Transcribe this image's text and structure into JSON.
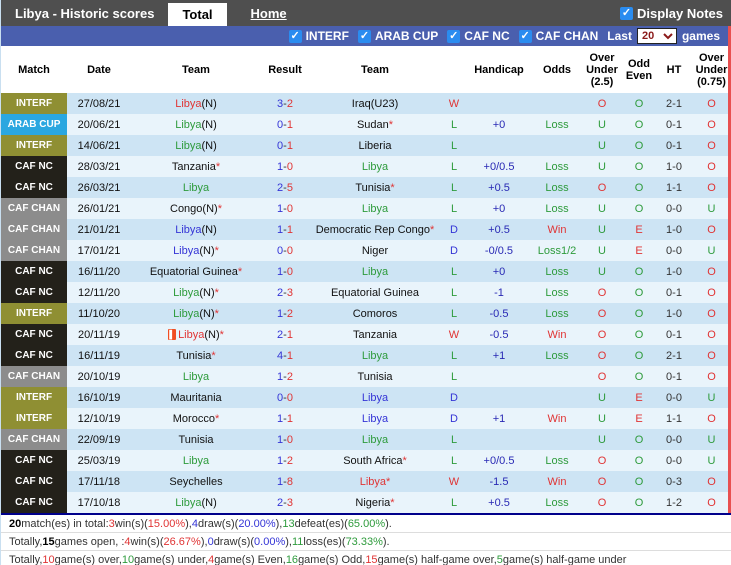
{
  "header": {
    "title": "Libya - Historic scores",
    "tabs": [
      {
        "label": "Total",
        "active": true
      },
      {
        "label": "Home",
        "active": false
      }
    ],
    "display_notes_label": "Display Notes",
    "display_notes_checked": true
  },
  "filter_bar": {
    "competitions": [
      {
        "label": "INTERF",
        "checked": true
      },
      {
        "label": "ARAB CUP",
        "checked": true
      },
      {
        "label": "CAF NC",
        "checked": true
      },
      {
        "label": "CAF CHAN",
        "checked": true
      }
    ],
    "last_label": "Last",
    "last_value": "20",
    "games_label": "games"
  },
  "colors": {
    "win_red": "#e03434",
    "loss_green": "#2e9b3c",
    "draw_blue": "#3434d6",
    "handicap_navy": "#2828b4",
    "badge_interf": "#8f8f33",
    "badge_arab_cup": "#2aa7e0",
    "badge_caf_nc": "#23211a",
    "badge_caf_chan": "#8c8c8c",
    "stripe_dark": "#cde4f4",
    "stripe_light": "#e9f4fb",
    "filter_bar_blue": "#4a5fae",
    "topbar_gray": "#4f4f4f",
    "right_edge_red": "#e85050"
  },
  "table": {
    "headers": [
      "Match",
      "Date",
      "Team",
      "Result",
      "Team",
      "",
      "Handicap",
      "Odds",
      "Over Under (2.5)",
      "Odd Even",
      "HT",
      "Over Under (0.75)"
    ],
    "rows": [
      {
        "comp": "INTERF",
        "date": "27/08/21",
        "t1": "Libya",
        "t1s": "(N)",
        "t1r": "W",
        "t1star": false,
        "card": false,
        "rh": "3",
        "ra": "2",
        "t2": "Iraq(U23)",
        "t2s": "",
        "t2r": "",
        "t2star": false,
        "wld": "W",
        "hcap": "",
        "odds": "",
        "ou25": "O",
        "oe": "O",
        "ht": "2-1",
        "ou075": "O"
      },
      {
        "comp": "ARAB CUP",
        "date": "20/06/21",
        "t1": "Libya",
        "t1s": "(N)",
        "t1r": "L",
        "t1star": false,
        "card": false,
        "rh": "0",
        "ra": "1",
        "t2": "Sudan",
        "t2s": "",
        "t2r": "",
        "t2star": true,
        "wld": "L",
        "hcap": "+0",
        "odds": "Loss",
        "ou25": "U",
        "oe": "O",
        "ht": "0-1",
        "ou075": "O"
      },
      {
        "comp": "INTERF",
        "date": "14/06/21",
        "t1": "Libya",
        "t1s": "(N)",
        "t1r": "L",
        "t1star": false,
        "card": false,
        "rh": "0",
        "ra": "1",
        "t2": "Liberia",
        "t2s": "",
        "t2r": "",
        "t2star": false,
        "wld": "L",
        "hcap": "",
        "odds": "",
        "ou25": "U",
        "oe": "O",
        "ht": "0-1",
        "ou075": "O"
      },
      {
        "comp": "CAF NC",
        "date": "28/03/21",
        "t1": "Tanzania",
        "t1s": "",
        "t1r": "",
        "t1star": true,
        "card": false,
        "rh": "1",
        "ra": "0",
        "t2": "Libya",
        "t2s": "",
        "t2r": "L",
        "t2star": false,
        "wld": "L",
        "hcap": "+0/0.5",
        "odds": "Loss",
        "ou25": "U",
        "oe": "O",
        "ht": "1-0",
        "ou075": "O"
      },
      {
        "comp": "CAF NC",
        "date": "26/03/21",
        "t1": "Libya",
        "t1s": "",
        "t1r": "L",
        "t1star": false,
        "card": false,
        "rh": "2",
        "ra": "5",
        "t2": "Tunisia",
        "t2s": "",
        "t2r": "",
        "t2star": true,
        "wld": "L",
        "hcap": "+0.5",
        "odds": "Loss",
        "ou25": "O",
        "oe": "O",
        "ht": "1-1",
        "ou075": "O"
      },
      {
        "comp": "CAF CHAN",
        "date": "26/01/21",
        "t1": "Congo",
        "t1s": "(N)",
        "t1r": "",
        "t1star": true,
        "card": false,
        "rh": "1",
        "ra": "0",
        "t2": "Libya",
        "t2s": "",
        "t2r": "L",
        "t2star": false,
        "wld": "L",
        "hcap": "+0",
        "odds": "Loss",
        "ou25": "U",
        "oe": "O",
        "ht": "0-0",
        "ou075": "U"
      },
      {
        "comp": "CAF CHAN",
        "date": "21/01/21",
        "t1": "Libya",
        "t1s": "(N)",
        "t1r": "D",
        "t1star": false,
        "card": false,
        "rh": "1",
        "ra": "1",
        "t2": "Democratic Rep Congo",
        "t2s": "",
        "t2r": "",
        "t2star": true,
        "wld": "D",
        "hcap": "+0.5",
        "odds": "Win",
        "ou25": "U",
        "oe": "E",
        "ht": "1-0",
        "ou075": "O"
      },
      {
        "comp": "CAF CHAN",
        "date": "17/01/21",
        "t1": "Libya",
        "t1s": "(N)",
        "t1r": "D",
        "t1star": true,
        "card": false,
        "rh": "0",
        "ra": "0",
        "t2": "Niger",
        "t2s": "",
        "t2r": "",
        "t2star": false,
        "wld": "D",
        "hcap": "-0/0.5",
        "odds": "Loss1/2",
        "ou25": "U",
        "oe": "E",
        "ht": "0-0",
        "ou075": "U"
      },
      {
        "comp": "CAF NC",
        "date": "16/11/20",
        "t1": "Equatorial Guinea",
        "t1s": "",
        "t1r": "",
        "t1star": true,
        "card": false,
        "rh": "1",
        "ra": "0",
        "t2": "Libya",
        "t2s": "",
        "t2r": "L",
        "t2star": false,
        "wld": "L",
        "hcap": "+0",
        "odds": "Loss",
        "ou25": "U",
        "oe": "O",
        "ht": "1-0",
        "ou075": "O"
      },
      {
        "comp": "CAF NC",
        "date": "12/11/20",
        "t1": "Libya",
        "t1s": "(N)",
        "t1r": "L",
        "t1star": true,
        "card": false,
        "rh": "2",
        "ra": "3",
        "t2": "Equatorial Guinea",
        "t2s": "",
        "t2r": "",
        "t2star": false,
        "wld": "L",
        "hcap": "-1",
        "odds": "Loss",
        "ou25": "O",
        "oe": "O",
        "ht": "0-1",
        "ou075": "O"
      },
      {
        "comp": "INTERF",
        "date": "11/10/20",
        "t1": "Libya",
        "t1s": "(N)",
        "t1r": "L",
        "t1star": true,
        "card": false,
        "rh": "1",
        "ra": "2",
        "t2": "Comoros",
        "t2s": "",
        "t2r": "",
        "t2star": false,
        "wld": "L",
        "hcap": "-0.5",
        "odds": "Loss",
        "ou25": "O",
        "oe": "O",
        "ht": "1-0",
        "ou075": "O"
      },
      {
        "comp": "CAF NC",
        "date": "20/11/19",
        "t1": "Libya",
        "t1s": "(N)",
        "t1r": "W",
        "t1star": true,
        "card": true,
        "rh": "2",
        "ra": "1",
        "t2": "Tanzania",
        "t2s": "",
        "t2r": "",
        "t2star": false,
        "wld": "W",
        "hcap": "-0.5",
        "odds": "Win",
        "ou25": "O",
        "oe": "O",
        "ht": "0-1",
        "ou075": "O"
      },
      {
        "comp": "CAF NC",
        "date": "16/11/19",
        "t1": "Tunisia",
        "t1s": "",
        "t1r": "",
        "t1star": true,
        "card": false,
        "rh": "4",
        "ra": "1",
        "t2": "Libya",
        "t2s": "",
        "t2r": "L",
        "t2star": false,
        "wld": "L",
        "hcap": "+1",
        "odds": "Loss",
        "ou25": "O",
        "oe": "O",
        "ht": "2-1",
        "ou075": "O"
      },
      {
        "comp": "CAF CHAN",
        "date": "20/10/19",
        "t1": "Libya",
        "t1s": "",
        "t1r": "L",
        "t1star": false,
        "card": false,
        "rh": "1",
        "ra": "2",
        "t2": "Tunisia",
        "t2s": "",
        "t2r": "",
        "t2star": false,
        "wld": "L",
        "hcap": "",
        "odds": "",
        "ou25": "O",
        "oe": "O",
        "ht": "0-1",
        "ou075": "O"
      },
      {
        "comp": "INTERF",
        "date": "16/10/19",
        "t1": "Mauritania",
        "t1s": "",
        "t1r": "",
        "t1star": false,
        "card": false,
        "rh": "0",
        "ra": "0",
        "t2": "Libya",
        "t2s": "",
        "t2r": "D",
        "t2star": false,
        "wld": "D",
        "hcap": "",
        "odds": "",
        "ou25": "U",
        "oe": "E",
        "ht": "0-0",
        "ou075": "U"
      },
      {
        "comp": "INTERF",
        "date": "12/10/19",
        "t1": "Morocco",
        "t1s": "",
        "t1r": "",
        "t1star": true,
        "card": false,
        "rh": "1",
        "ra": "1",
        "t2": "Libya",
        "t2s": "",
        "t2r": "D",
        "t2star": false,
        "wld": "D",
        "hcap": "+1",
        "odds": "Win",
        "ou25": "U",
        "oe": "E",
        "ht": "1-1",
        "ou075": "O"
      },
      {
        "comp": "CAF CHAN",
        "date": "22/09/19",
        "t1": "Tunisia",
        "t1s": "",
        "t1r": "",
        "t1star": false,
        "card": false,
        "rh": "1",
        "ra": "0",
        "t2": "Libya",
        "t2s": "",
        "t2r": "L",
        "t2star": false,
        "wld": "L",
        "hcap": "",
        "odds": "",
        "ou25": "U",
        "oe": "O",
        "ht": "0-0",
        "ou075": "U"
      },
      {
        "comp": "CAF NC",
        "date": "25/03/19",
        "t1": "Libya",
        "t1s": "",
        "t1r": "L",
        "t1star": false,
        "card": false,
        "rh": "1",
        "ra": "2",
        "t2": "South Africa",
        "t2s": "",
        "t2r": "",
        "t2star": true,
        "wld": "L",
        "hcap": "+0/0.5",
        "odds": "Loss",
        "ou25": "O",
        "oe": "O",
        "ht": "0-0",
        "ou075": "U"
      },
      {
        "comp": "CAF NC",
        "date": "17/11/18",
        "t1": "Seychelles",
        "t1s": "",
        "t1r": "",
        "t1star": false,
        "card": false,
        "rh": "1",
        "ra": "8",
        "t2": "Libya",
        "t2s": "",
        "t2r": "W",
        "t2star": true,
        "wld": "W",
        "hcap": "-1.5",
        "odds": "Win",
        "ou25": "O",
        "oe": "O",
        "ht": "0-3",
        "ou075": "O"
      },
      {
        "comp": "CAF NC",
        "date": "17/10/18",
        "t1": "Libya",
        "t1s": "(N)",
        "t1r": "L",
        "t1star": false,
        "card": false,
        "rh": "2",
        "ra": "3",
        "t2": "Nigeria",
        "t2s": "",
        "t2r": "",
        "t2star": true,
        "wld": "L",
        "hcap": "+0.5",
        "odds": "Loss",
        "ou25": "O",
        "oe": "O",
        "ht": "1-2",
        "ou075": "O"
      }
    ]
  },
  "summary": {
    "lines": [
      [
        {
          "t": "20",
          "c": "b"
        },
        {
          "t": " match(es) in total: "
        },
        {
          "t": "3",
          "c": "red"
        },
        {
          "t": " win(s)("
        },
        {
          "t": "15.00%",
          "c": "red"
        },
        {
          "t": "), "
        },
        {
          "t": "4",
          "c": "blue"
        },
        {
          "t": " draw(s)("
        },
        {
          "t": "20.00%",
          "c": "blue"
        },
        {
          "t": "), "
        },
        {
          "t": "13",
          "c": "green"
        },
        {
          "t": " defeat(es)("
        },
        {
          "t": "65.00%",
          "c": "green"
        },
        {
          "t": ")."
        }
      ],
      [
        {
          "t": "Totally, "
        },
        {
          "t": "15",
          "c": "b"
        },
        {
          "t": " games open, : "
        },
        {
          "t": "4",
          "c": "red"
        },
        {
          "t": " win(s)("
        },
        {
          "t": "26.67%",
          "c": "red"
        },
        {
          "t": "), "
        },
        {
          "t": "0",
          "c": "blue"
        },
        {
          "t": " draw(s)("
        },
        {
          "t": "0.00%",
          "c": "blue"
        },
        {
          "t": "), "
        },
        {
          "t": "11",
          "c": "green"
        },
        {
          "t": " loss(es)("
        },
        {
          "t": "73.33%",
          "c": "green"
        },
        {
          "t": ")."
        }
      ],
      [
        {
          "t": "Totally, "
        },
        {
          "t": "10",
          "c": "red"
        },
        {
          "t": " game(s) over, "
        },
        {
          "t": "10",
          "c": "green"
        },
        {
          "t": " game(s) under, "
        },
        {
          "t": "4",
          "c": "red"
        },
        {
          "t": " game(s) Even, "
        },
        {
          "t": "16",
          "c": "green"
        },
        {
          "t": " game(s) Odd, "
        },
        {
          "t": "15",
          "c": "red"
        },
        {
          "t": " game(s) half-game over, "
        },
        {
          "t": "5",
          "c": "green"
        },
        {
          "t": " game(s) half-game under"
        }
      ]
    ]
  }
}
